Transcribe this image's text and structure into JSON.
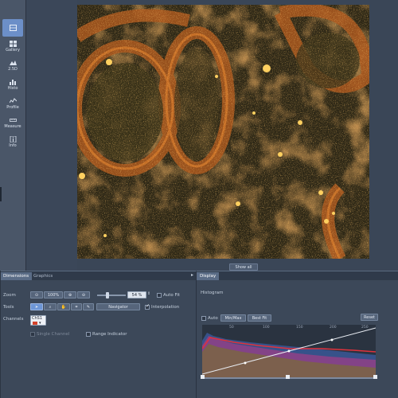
{
  "rail": {
    "items": [
      {
        "label": "",
        "icon": "view-2d-icon",
        "active": true
      },
      {
        "label": "Gallery",
        "icon": "gallery-icon"
      },
      {
        "label": "2.5D",
        "icon": "2-5d-icon"
      },
      {
        "label": "Histo",
        "icon": "histo-icon"
      },
      {
        "label": "Profile",
        "icon": "profile-icon"
      },
      {
        "label": "Measure",
        "icon": "measure-icon"
      },
      {
        "label": "Info",
        "icon": "info-icon"
      }
    ]
  },
  "viewer": {
    "show_all": "Show all"
  },
  "left_panel": {
    "tabs": [
      "Dimensions",
      "Graphics"
    ],
    "zoom_label": "Zoom",
    "zoom_fit_label": "100%",
    "zoom_value": "54 %",
    "auto_fit": "Auto Fit",
    "tools_label": "Tools",
    "navigator": "Navigator",
    "interpolation": "Interpolation",
    "channels_label": "Channels",
    "channel_name": "ChS1",
    "single_channel": "Single Channel",
    "range_indicator": "Range Indicator"
  },
  "right_panel": {
    "tab": "Display",
    "histogram_title": "Histogram",
    "auto": "Auto",
    "min_max": "Min/Max",
    "best_fit": "Best Fit",
    "reset": "Reset",
    "ticks": [
      "50",
      "100",
      "150",
      "200",
      "250"
    ]
  },
  "colors": {
    "accent": "#6c8fc8",
    "panel": "#3c4859",
    "background": "#3a4657"
  }
}
